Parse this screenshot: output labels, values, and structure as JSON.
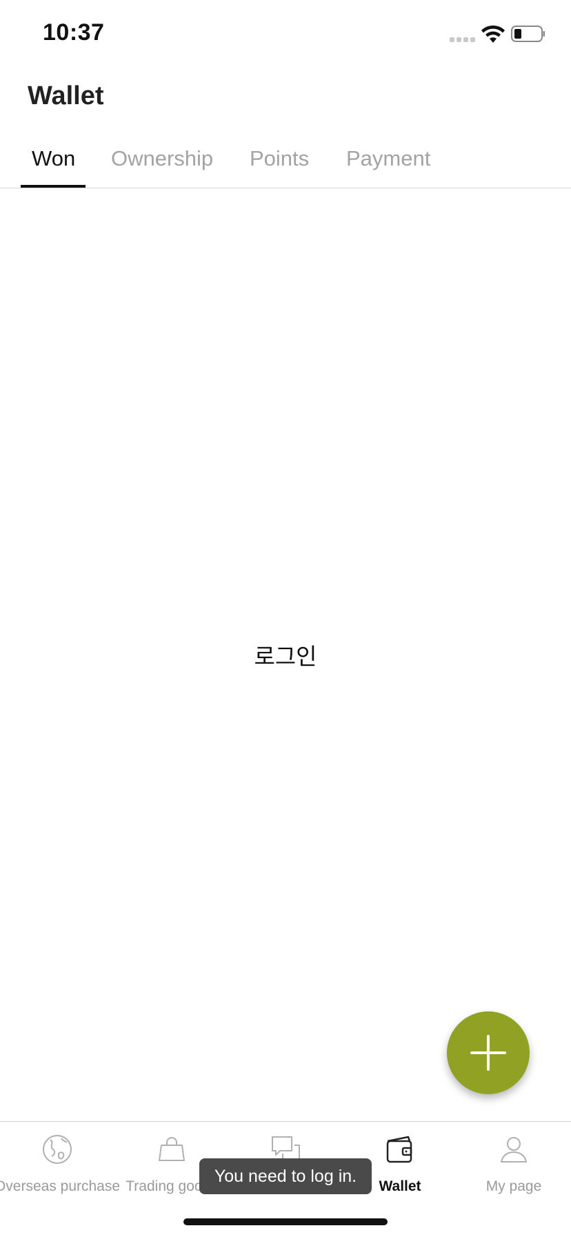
{
  "status_bar": {
    "time": "10:37",
    "icons": [
      "cellular-signal-icon",
      "wifi-icon",
      "battery-icon"
    ]
  },
  "header": {
    "title": "Wallet"
  },
  "tabs": [
    {
      "label": "Won",
      "active": true
    },
    {
      "label": "Ownership",
      "active": false
    },
    {
      "label": "Points",
      "active": false
    },
    {
      "label": "Payment",
      "active": false
    }
  ],
  "main": {
    "login_text": "로그인"
  },
  "fab": {
    "icon": "plus-icon",
    "color": "#91a124"
  },
  "bottom_nav": {
    "items": [
      {
        "label": "Overseas purchase",
        "icon": "globe-icon",
        "active": false
      },
      {
        "label": "Trading goods",
        "icon": "shopping-bag-icon",
        "active": false
      },
      {
        "label": "",
        "icon": "chat-bubbles-icon",
        "active": false
      },
      {
        "label": "Wallet",
        "icon": "wallet-icon",
        "active": true
      },
      {
        "label": "My page",
        "icon": "person-icon",
        "active": false
      }
    ]
  },
  "toast": {
    "message": "You need to log in."
  },
  "colors": {
    "accent": "#91a124",
    "active_text": "#111111",
    "inactive_text": "#a3a3a3",
    "toast_bg": "#4a4a4a"
  }
}
